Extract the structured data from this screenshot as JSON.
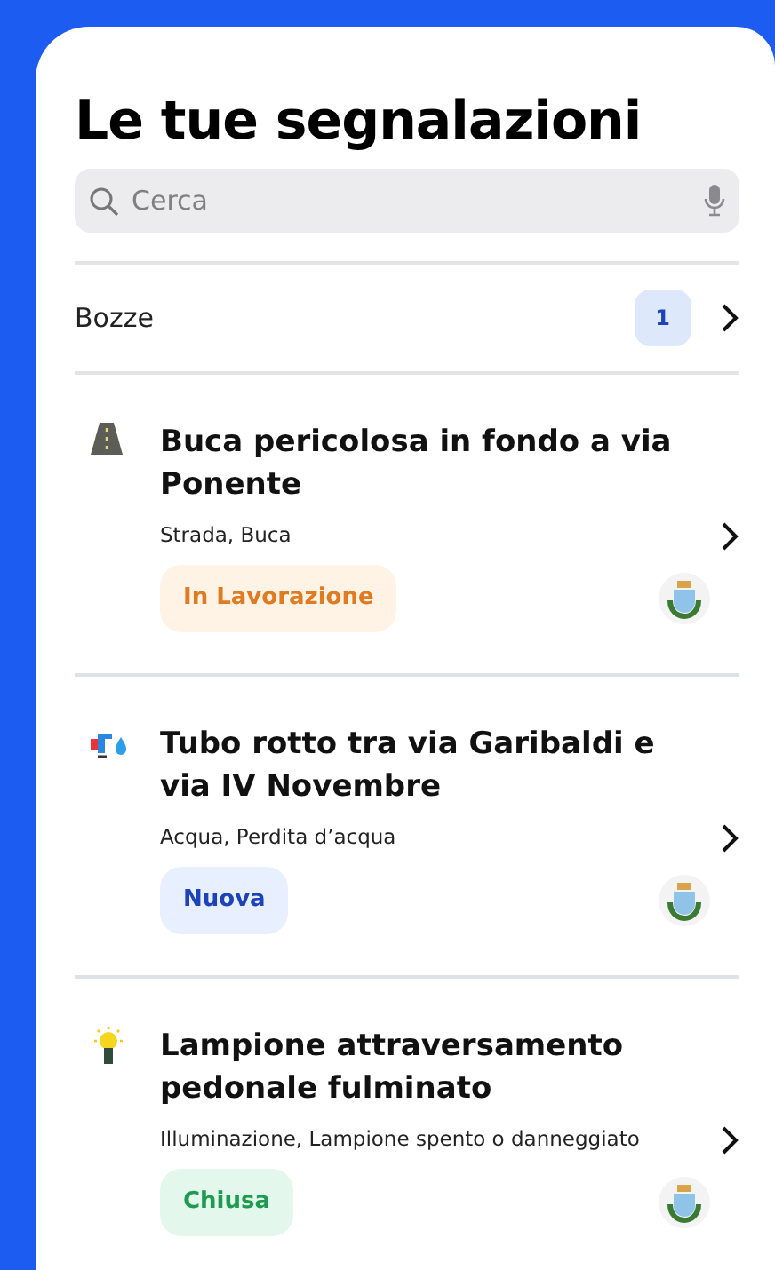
{
  "title": "Le tue segnalazioni",
  "search": {
    "placeholder": "Cerca"
  },
  "drafts": {
    "label": "Bozze",
    "count": "1"
  },
  "reports": [
    {
      "kind": "road",
      "title": "Buca pericolosa in fondo a via Ponente",
      "category": "Strada, Buca",
      "status": {
        "kind": "in_progress",
        "label": "In Lavorazione"
      }
    },
    {
      "kind": "water",
      "title": "Tubo rotto tra via Garibaldi e via IV Novembre",
      "category": "Acqua, Perdita d’acqua",
      "status": {
        "kind": "new",
        "label": "Nuova"
      }
    },
    {
      "kind": "light",
      "title": "Lampione attraversamento pedonale fulminato",
      "category": "Illuminazione, Lampione spento o danneggiato",
      "status": {
        "kind": "closed",
        "label": "Chiusa"
      }
    }
  ]
}
